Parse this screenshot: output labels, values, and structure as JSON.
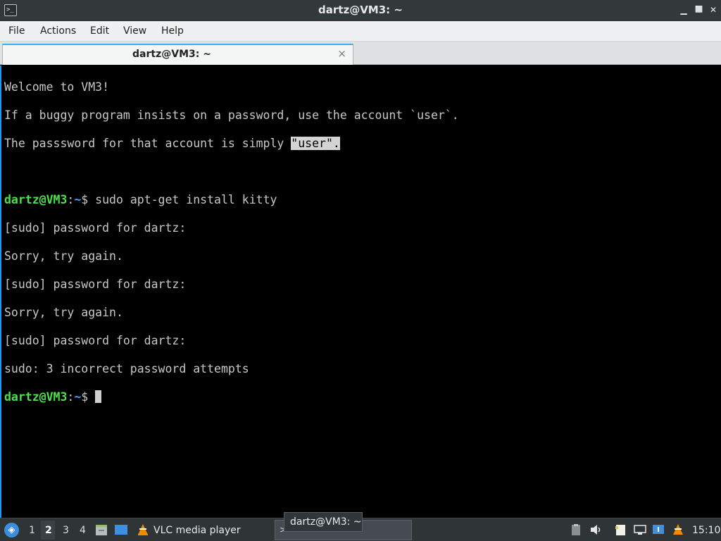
{
  "window": {
    "title": "dartz@VM3: ~",
    "minimize_glyph": "▁",
    "maximize_glyph": "⬜",
    "close_glyph": "✕"
  },
  "menu": [
    "File",
    "Actions",
    "Edit",
    "View",
    "Help"
  ],
  "tab": {
    "label": "dartz@VM3: ~",
    "close_glyph": "×"
  },
  "terminal": {
    "welcome": "Welcome to VM3!",
    "notice1": "If a buggy program insists on a password, use the account `user`.",
    "notice2_prefix": "The passsword for that account is simply ",
    "notice2_selected": "\"user\".",
    "prompt_user": "dartz@VM3",
    "prompt_sep": ":",
    "prompt_dir": "~",
    "prompt_symbol": "$ ",
    "command": "sudo apt-get install kitty",
    "sudo_prompt": "[sudo] password for dartz:",
    "retry": "Sorry, try again.",
    "failure": "sudo: 3 incorrect password attempts"
  },
  "taskbar": {
    "workspaces": [
      "1",
      "2",
      "3",
      "4"
    ],
    "active_workspace": "2",
    "vlc_label": "VLC media player",
    "terminal_task_label": "dartz@VM3: ~",
    "clock": "15:10"
  },
  "tooltip": "dartz@VM3: ~",
  "colors": {
    "prompt_user": "#4ce04c",
    "prompt_dir": "#3aa8ff",
    "accent": "#3daee9"
  }
}
